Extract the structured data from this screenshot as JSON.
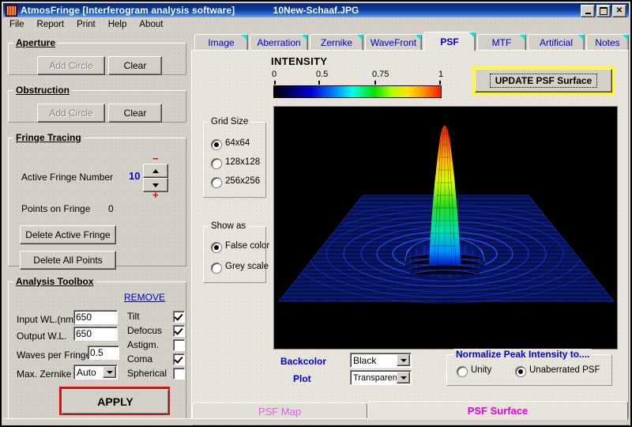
{
  "window": {
    "app_title": "AtmosFringe  [Interferogram analysis software]",
    "document_title": "10New-Schaaf.JPG",
    "icon": "app-icon",
    "buttons": {
      "minimize": "minimize-button",
      "maximize": "maximize-button",
      "close": "✕"
    }
  },
  "menu": {
    "items": [
      "File",
      "Report",
      "Print",
      "Help",
      "About"
    ]
  },
  "aperture": {
    "legend": "Aperture",
    "add_circle": "Add Circle",
    "clear": "Clear"
  },
  "obstruction": {
    "legend": "Obstruction",
    "add_circle": "Add Circle",
    "clear": "Clear"
  },
  "fringe_tracing": {
    "legend": "Fringe Tracing",
    "active_fringe_label": "Active Fringe Number",
    "active_fringe_value": "10",
    "minus_sign": "−",
    "plus_sign": "+",
    "points_label": "Points on  Fringe",
    "points_value": "0",
    "delete_active": "Delete Active Fringe",
    "delete_all": "Delete  All  Points"
  },
  "analysis_toolbox": {
    "legend": "Analysis  Toolbox",
    "remove_link": "REMOVE",
    "fields": [
      {
        "label": "Input WL.(nm)",
        "value": "650"
      },
      {
        "label": "Output W.L.",
        "value": "650"
      },
      {
        "label": "Waves per Fringe",
        "value": "0.5"
      }
    ],
    "max_zernike_label": "Max. Zernike",
    "max_zernike_value": "Auto",
    "aberrations": [
      {
        "label": "Tilt",
        "checked": true
      },
      {
        "label": "Defocus",
        "checked": true
      },
      {
        "label": "Astigm.",
        "checked": false
      },
      {
        "label": "Coma",
        "checked": true
      },
      {
        "label": "Spherical",
        "checked": false
      }
    ],
    "apply_label": "APPLY",
    "apply_highlight_color": "#ff0000"
  },
  "tabs": {
    "items": [
      "Image",
      "Aberration",
      "Zernike",
      "WaveFront",
      "PSF",
      "MTF",
      "Artificial",
      "Notes"
    ],
    "active": "PSF"
  },
  "psf_panel": {
    "intensity_title": "INTENSITY",
    "colorbar_ticks": [
      "0",
      "0.5",
      "0.75",
      "1"
    ],
    "update_button": "UPDATE  PSF  Surface",
    "update_highlight_color": "#ffff00",
    "grid_size": {
      "legend": "Grid Size",
      "options": [
        "64x64",
        "128x128",
        "256x256"
      ],
      "selected": "64x64"
    },
    "show_as": {
      "legend": "Show as",
      "options": [
        "False color",
        "Grey scale"
      ],
      "selected": "False color"
    },
    "backcolor_label": "Backcolor",
    "backcolor_value": "Black",
    "plot_label": "Plot",
    "plot_value": "Transparent",
    "normalize": {
      "title": "Normalize Peak Intensity to....",
      "options": [
        "Unity",
        "Unaberrated PSF"
      ],
      "selected": "Unaberrated PSF"
    },
    "bottom_tabs": {
      "items": [
        "PSF  Map",
        "PSF Surface"
      ],
      "active": "PSF Surface"
    }
  },
  "chart_data": {
    "type": "surface",
    "title": "PSF Surface",
    "colormap": "jet",
    "background": "#000000",
    "zlabel": "INTENSITY",
    "zlim": [
      0,
      1
    ],
    "grid": "64x64",
    "description": "3D wireframe surface of a point-spread function: a tall narrow central Airy core peaking at normalized intensity 1 (red tip) surrounded by concentric low-amplitude diffraction rings on a dark-blue base plane.",
    "colorbar_ticks": [
      0,
      0.5,
      0.75,
      1
    ],
    "peak_intensity": 1.0,
    "base_level": 0.02
  }
}
